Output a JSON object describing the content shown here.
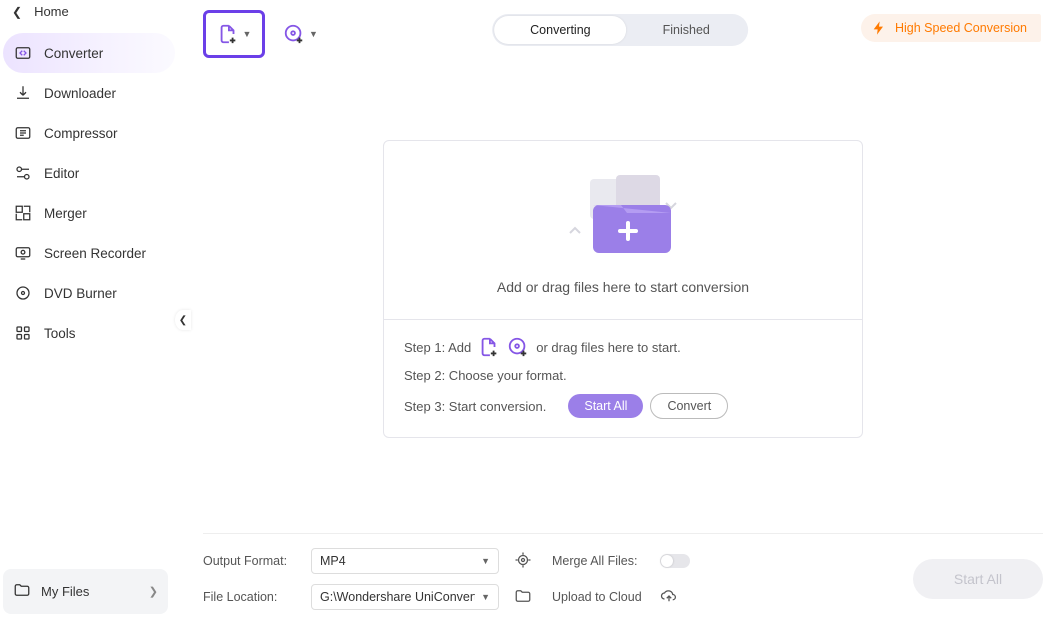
{
  "home": "Home",
  "sidebar": {
    "items": [
      {
        "label": "Converter",
        "active": true
      },
      {
        "label": "Downloader"
      },
      {
        "label": "Compressor"
      },
      {
        "label": "Editor"
      },
      {
        "label": "Merger"
      },
      {
        "label": "Screen Recorder"
      },
      {
        "label": "DVD Burner"
      },
      {
        "label": "Tools"
      }
    ]
  },
  "myfiles": "My Files",
  "tabs": {
    "converting": "Converting",
    "finished": "Finished"
  },
  "hsc": "High Speed Conversion",
  "dz_text": "Add or drag files here to start conversion",
  "steps": {
    "s1_pre": "Step 1: Add",
    "s1_post": "or drag files here to start.",
    "s2": "Step 2: Choose your format.",
    "s3": "Step 3: Start conversion.",
    "start_all": "Start All",
    "convert": "Convert"
  },
  "footer": {
    "out_label": "Output Format:",
    "out_value": "MP4",
    "loc_label": "File Location:",
    "loc_value": "G:\\Wondershare UniConverter ",
    "merge_label": "Merge All Files:",
    "upload_label": "Upload to Cloud",
    "start_all": "Start All"
  }
}
